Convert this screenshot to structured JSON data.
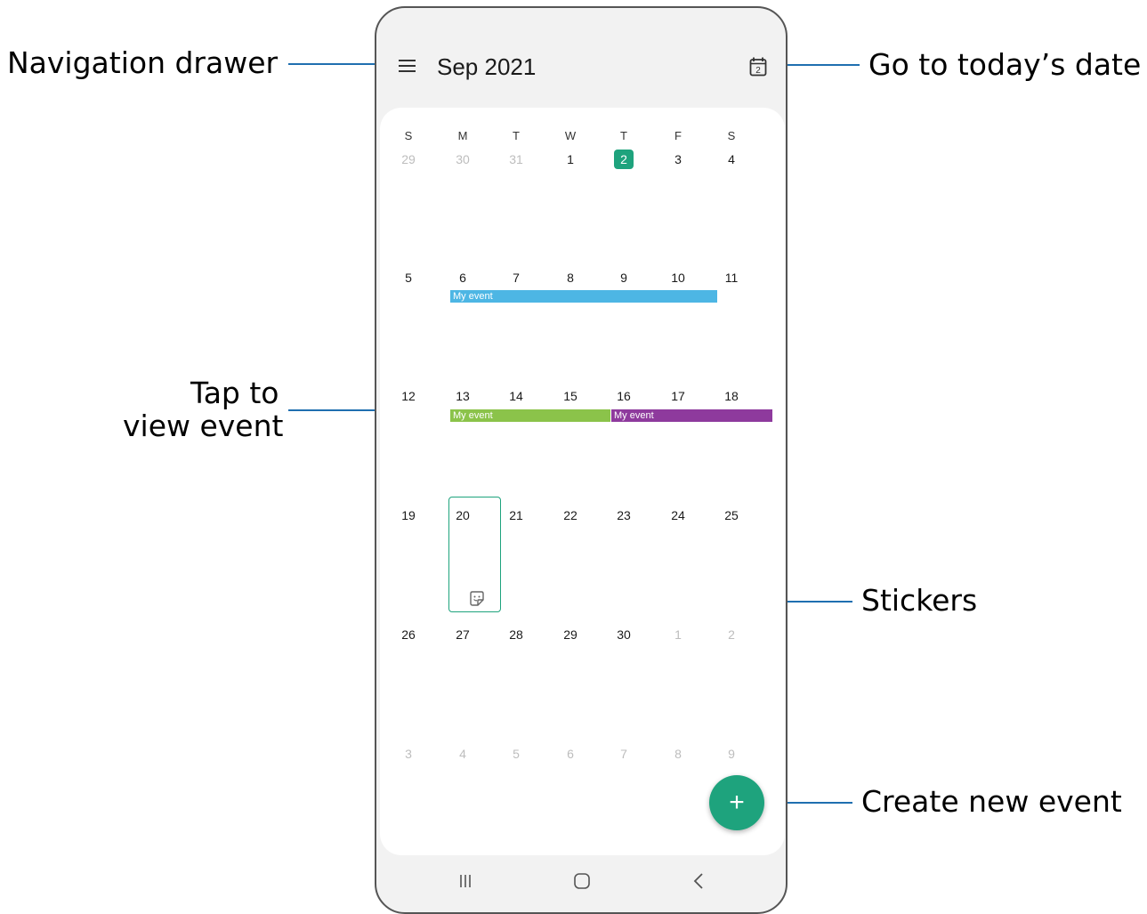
{
  "callouts": {
    "navigation_drawer": "Navigation drawer",
    "go_to_today": "Go to today’s date",
    "tap_to_view_line1": "Tap to",
    "tap_to_view_line2": "view event",
    "stickers": "Stickers",
    "create_new_event": "Create new event"
  },
  "header": {
    "month_title": "Sep  2021",
    "today_icon_date": "2",
    "menu_icon": "hamburger-menu-icon"
  },
  "weekdays": [
    "S",
    "M",
    "T",
    "W",
    "T",
    "F",
    "S"
  ],
  "weeks": [
    [
      {
        "d": "29",
        "faded": true
      },
      {
        "d": "30",
        "faded": true
      },
      {
        "d": "31",
        "faded": true
      },
      {
        "d": "1"
      },
      {
        "d": "2",
        "today": true
      },
      {
        "d": "3"
      },
      {
        "d": "4"
      }
    ],
    [
      {
        "d": "5"
      },
      {
        "d": "6"
      },
      {
        "d": "7"
      },
      {
        "d": "8"
      },
      {
        "d": "9"
      },
      {
        "d": "10"
      },
      {
        "d": "11"
      }
    ],
    [
      {
        "d": "12"
      },
      {
        "d": "13"
      },
      {
        "d": "14"
      },
      {
        "d": "15"
      },
      {
        "d": "16"
      },
      {
        "d": "17"
      },
      {
        "d": "18"
      }
    ],
    [
      {
        "d": "19"
      },
      {
        "d": "20"
      },
      {
        "d": "21"
      },
      {
        "d": "22"
      },
      {
        "d": "23"
      },
      {
        "d": "24"
      },
      {
        "d": "25"
      }
    ],
    [
      {
        "d": "26"
      },
      {
        "d": "27"
      },
      {
        "d": "28"
      },
      {
        "d": "29"
      },
      {
        "d": "30"
      },
      {
        "d": "1",
        "faded": true
      },
      {
        "d": "2",
        "faded": true
      }
    ],
    [
      {
        "d": "3",
        "faded": true
      },
      {
        "d": "4",
        "faded": true
      },
      {
        "d": "5",
        "faded": true
      },
      {
        "d": "6",
        "faded": true
      },
      {
        "d": "7",
        "faded": true
      },
      {
        "d": "8",
        "faded": true
      },
      {
        "d": "9",
        "faded": true
      }
    ]
  ],
  "events": [
    {
      "label": "My event",
      "color": "#4db6e4"
    },
    {
      "label": "My event",
      "color": "#8bc34a"
    },
    {
      "label": "My event",
      "color": "#8e3a9d"
    }
  ],
  "colors": {
    "accent": "#1ea37d",
    "callout_line": "#1f6fb0"
  },
  "fab_icon": "plus-icon",
  "nav_icons": [
    "recent-apps-icon",
    "home-icon",
    "back-icon"
  ]
}
